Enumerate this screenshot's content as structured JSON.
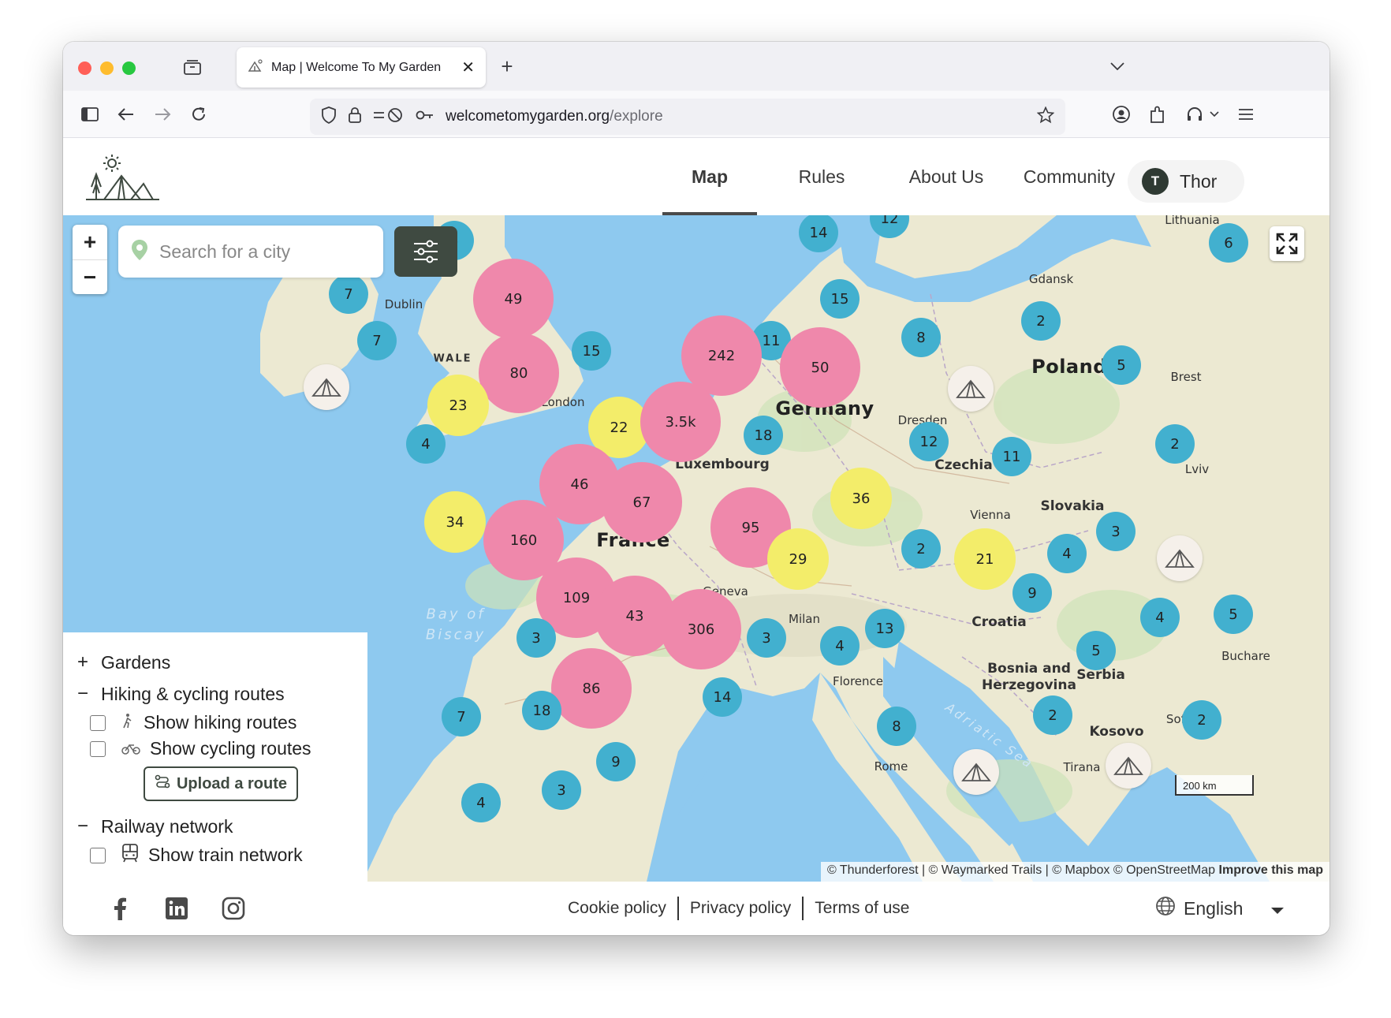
{
  "browser": {
    "tab_title": "Map | Welcome To My Garden",
    "url_domain": "welcometomygarden.org",
    "url_path": "/explore"
  },
  "header": {
    "nav": [
      "Map",
      "Rules",
      "About Us",
      "Community"
    ],
    "active_nav": "Map",
    "user": {
      "initial": "T",
      "name": "Thor"
    }
  },
  "map": {
    "search_placeholder": "Search for a city",
    "places": {
      "lithuania": "Lithuania",
      "gdansk": "Gdansk",
      "dublin": "Dublin",
      "wales": "WALE",
      "london": "London",
      "poland": "Poland",
      "brest": "Brest",
      "germany": "Germany",
      "dresden": "Dresden",
      "luxembourg": "Luxembourg",
      "czechia": "Czechia",
      "lviv": "Lviv",
      "slovakia": "Slovakia",
      "vienna": "Vienna",
      "france": "France",
      "geneva": "Geneva",
      "milan": "Milan",
      "croatia": "Croatia",
      "bosnia": "Bosnia and",
      "herzegovina": "Herzegovina",
      "serbia": "Serbia",
      "florence": "Florence",
      "bucharest": "Buchare",
      "sofia": "Sofi",
      "kosovo": "Kosovo",
      "rome": "Rome",
      "tirana": "Tirana",
      "bay1": "Bay of",
      "bay2": "Biscay",
      "adriatic": "Adriatic Sea"
    },
    "clusters": [
      {
        "count": "5",
        "color": "blue"
      },
      {
        "count": "14",
        "color": "blue"
      },
      {
        "count": "12",
        "color": "blue"
      },
      {
        "count": "6",
        "color": "blue"
      },
      {
        "count": "7",
        "color": "blue"
      },
      {
        "count": "49",
        "color": "pink"
      },
      {
        "count": "15",
        "color": "blue"
      },
      {
        "count": "2",
        "color": "blue"
      },
      {
        "count": "7",
        "color": "blue"
      },
      {
        "count": "11",
        "color": "blue"
      },
      {
        "count": "8",
        "color": "blue"
      },
      {
        "count": "242",
        "color": "pink"
      },
      {
        "count": "50",
        "color": "pink"
      },
      {
        "count": "80",
        "color": "pink"
      },
      {
        "count": "15",
        "color": "blue"
      },
      {
        "count": "5",
        "color": "blue"
      },
      {
        "count": "23",
        "color": "yellow"
      },
      {
        "count": "22",
        "color": "yellow"
      },
      {
        "count": "3.5k",
        "color": "pink"
      },
      {
        "count": "18",
        "color": "blue"
      },
      {
        "count": "4",
        "color": "blue"
      },
      {
        "count": "12",
        "color": "blue"
      },
      {
        "count": "11",
        "color": "blue"
      },
      {
        "count": "2",
        "color": "blue"
      },
      {
        "count": "46",
        "color": "pink"
      },
      {
        "count": "67",
        "color": "pink"
      },
      {
        "count": "36",
        "color": "yellow"
      },
      {
        "count": "34",
        "color": "yellow"
      },
      {
        "count": "160",
        "color": "pink"
      },
      {
        "count": "95",
        "color": "pink"
      },
      {
        "count": "3",
        "color": "blue"
      },
      {
        "count": "2",
        "color": "blue"
      },
      {
        "count": "21",
        "color": "yellow"
      },
      {
        "count": "4",
        "color": "blue"
      },
      {
        "count": "29",
        "color": "yellow"
      },
      {
        "count": "109",
        "color": "pink"
      },
      {
        "count": "43",
        "color": "pink"
      },
      {
        "count": "9",
        "color": "blue"
      },
      {
        "count": "306",
        "color": "pink"
      },
      {
        "count": "3",
        "color": "blue"
      },
      {
        "count": "4",
        "color": "blue"
      },
      {
        "count": "13",
        "color": "blue"
      },
      {
        "count": "4",
        "color": "blue"
      },
      {
        "count": "5",
        "color": "blue"
      },
      {
        "count": "3",
        "color": "blue"
      },
      {
        "count": "5",
        "color": "blue"
      },
      {
        "count": "86",
        "color": "pink"
      },
      {
        "count": "14",
        "color": "blue"
      },
      {
        "count": "7",
        "color": "blue"
      },
      {
        "count": "18",
        "color": "blue"
      },
      {
        "count": "8",
        "color": "blue"
      },
      {
        "count": "2",
        "color": "blue"
      },
      {
        "count": "2",
        "color": "blue"
      },
      {
        "count": "9",
        "color": "blue"
      },
      {
        "count": "3",
        "color": "blue"
      },
      {
        "count": "4",
        "color": "blue"
      }
    ],
    "legend": {
      "gardens": "Gardens",
      "routes": "Hiking & cycling routes",
      "show_hiking": "Show hiking routes",
      "show_cycling": "Show cycling routes",
      "upload_route": "Upload a route",
      "railway": "Railway network",
      "show_train": "Show train network"
    },
    "scale_label": "200 km",
    "attribution": "© Thunderforest | © Waymarked Trails | © Mapbox © OpenStreetMap",
    "improve_link": "Improve this map"
  },
  "footer": {
    "links": [
      "Cookie policy",
      "Privacy policy",
      "Terms of use"
    ],
    "language": "English"
  },
  "colors": {
    "cluster_blue": "#42b0cf",
    "cluster_pink": "#ef88ab",
    "cluster_yellow": "#f3ed6a",
    "brand_dark": "#3f4a41",
    "water": "#8ec9ef",
    "land": "#ece9d2"
  }
}
